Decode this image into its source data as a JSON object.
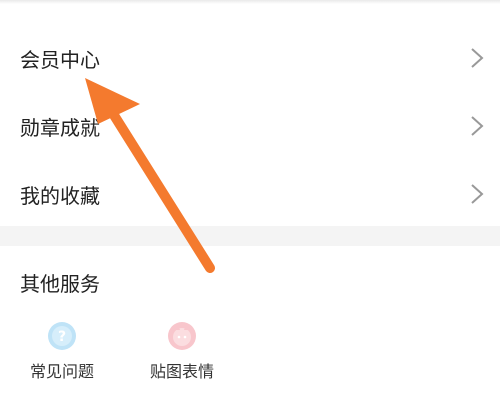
{
  "menu": [
    {
      "label": "会员中心",
      "icon": "chevron-right-icon"
    },
    {
      "label": "勋章成就",
      "icon": "chevron-right-icon"
    },
    {
      "label": "我的收藏",
      "icon": "chevron-right-icon"
    }
  ],
  "other_services": {
    "title": "其他服务",
    "items": [
      {
        "label": "常见问题",
        "icon": "question-circle-icon",
        "color": "#bfe3f7"
      },
      {
        "label": "贴图表情",
        "icon": "sticker-face-icon",
        "color": "#f8c6cc"
      }
    ]
  },
  "colors": {
    "text": "#222222",
    "chevron": "#999999",
    "divider_bg": "#f4f4f4",
    "arrow": "#f47a2e"
  },
  "annotation": {
    "icon": "orange-pointer-arrow-icon"
  }
}
